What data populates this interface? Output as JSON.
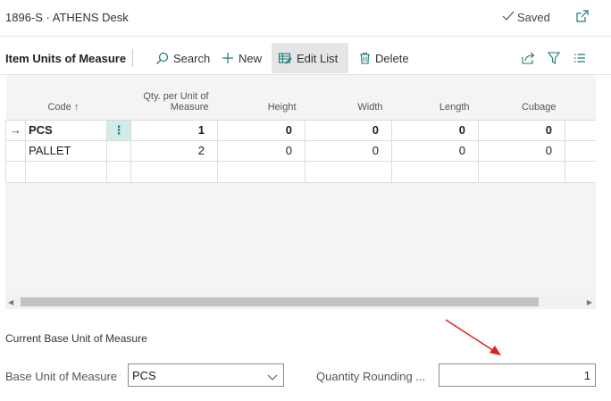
{
  "header": {
    "title": "1896-S · ATHENS Desk",
    "saved_label": "Saved"
  },
  "actionbar": {
    "section_title": "Item Units of Measure",
    "search_label": "Search",
    "new_label": "New",
    "edit_list_label": "Edit List",
    "delete_label": "Delete"
  },
  "grid": {
    "columns": [
      "Code ↑",
      "Qty. per Unit of Measure",
      "Height",
      "Width",
      "Length",
      "Cubage"
    ],
    "rows": [
      {
        "code": "PCS",
        "qty": "1",
        "height": "0",
        "width": "0",
        "length": "0",
        "cubage": "0",
        "active": true
      },
      {
        "code": "PALLET",
        "qty": "2",
        "height": "0",
        "width": "0",
        "length": "0",
        "cubage": "0",
        "active": false
      }
    ],
    "row_menu_glyph": "⋮",
    "current_row_glyph": "→"
  },
  "base_unit": {
    "section_title": "Current Base Unit of Measure",
    "base_label": "Base Unit of Measure",
    "base_value": "PCS",
    "qty_rounding_label": "Quantity Rounding ...",
    "qty_rounding_value": "1"
  },
  "colors": {
    "accent": "#0b7a75",
    "active_cell_bg": "#d2ece9",
    "annotation_arrow": "#e02020"
  },
  "icons": {
    "saved": "checkmark-icon",
    "popout": "popout-icon",
    "search": "search-icon",
    "new": "plus-icon",
    "edit_list": "edit-list-icon",
    "delete": "trash-icon",
    "share": "share-icon",
    "filter": "filter-icon",
    "list": "list-view-icon"
  }
}
